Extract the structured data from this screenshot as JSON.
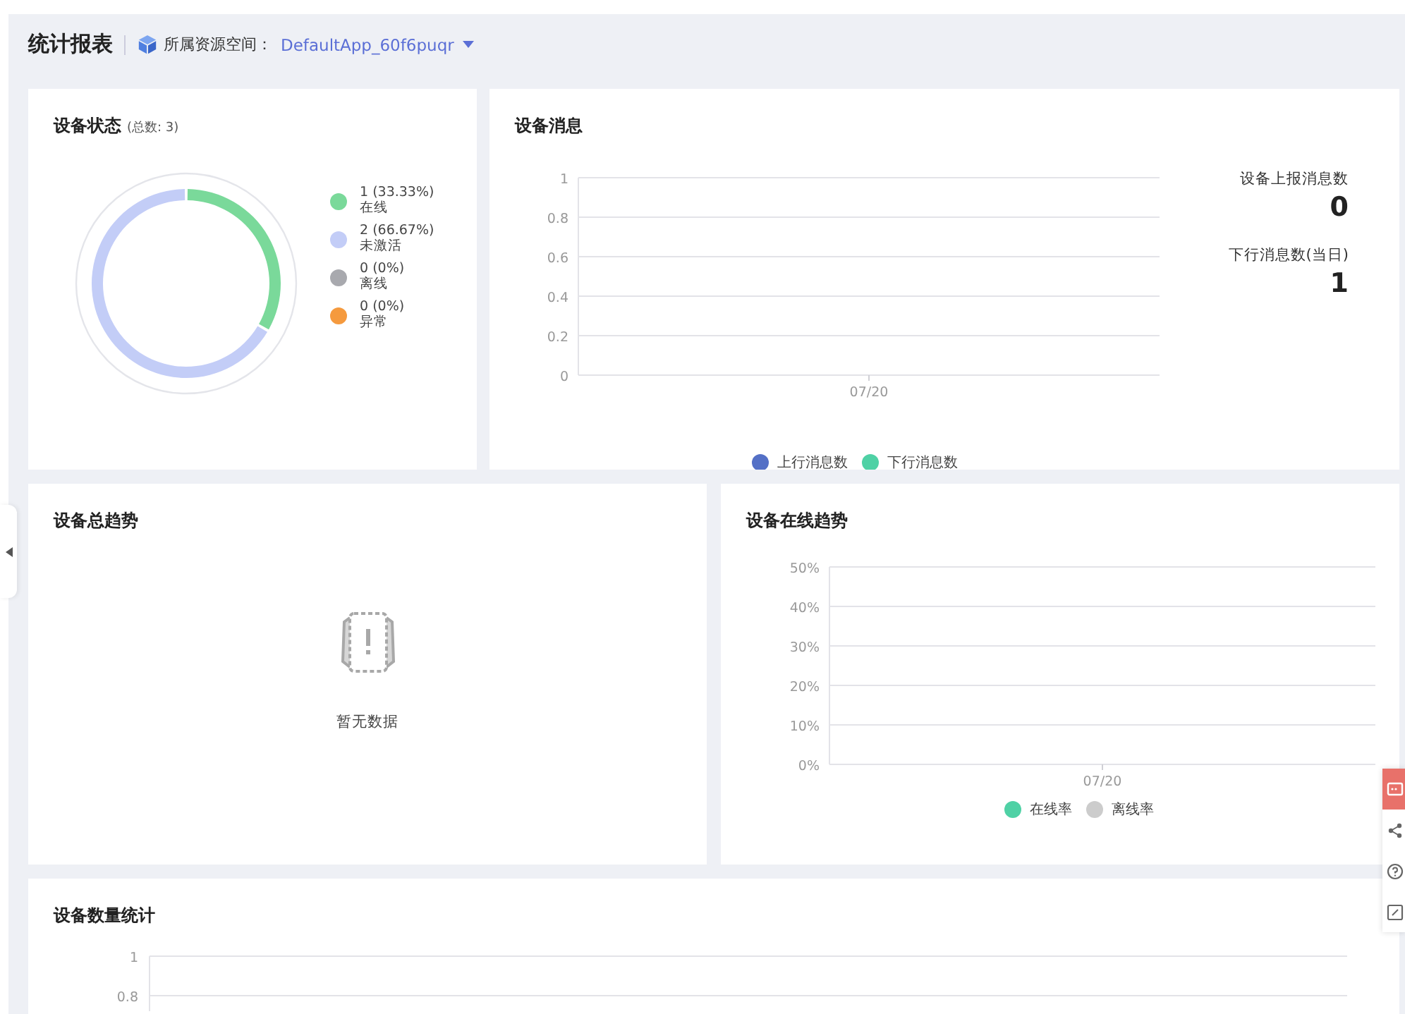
{
  "header": {
    "title": "统计报表",
    "space_label": "所属资源空间：",
    "space_value": "DefaultApp_60f6puqr"
  },
  "device_status": {
    "title": "设备状态",
    "total": "(总数: 3)",
    "legend": [
      {
        "value_label": "1 (33.33%)",
        "color": "#7ad99a"
      },
      {
        "value_label": "2 (66.67%)",
        "color": "#c3cdf7"
      },
      {
        "value_label": "0 (0%)",
        "color": "#a8a9ae"
      },
      {
        "value_label": "0 (0%)",
        "color": "#f59a3e"
      }
    ],
    "chart_data": {
      "type": "donut",
      "categories": [
        "在线",
        "未激活",
        "离线",
        "异常"
      ],
      "values": [
        33.33,
        66.67,
        0,
        0
      ]
    }
  },
  "device_messages": {
    "title": "设备消息",
    "chart_data": {
      "type": "line",
      "grid": true,
      "categories": [
        "07/20"
      ],
      "ylim": [
        0,
        1
      ],
      "yticks": [
        0,
        0.2,
        0.4,
        0.6,
        0.8,
        1
      ],
      "series": [
        {
          "name": "上行消息数",
          "color": "#5470c6",
          "values": [
            null
          ]
        },
        {
          "name": "下行消息数",
          "color": "#4fd1a5",
          "values": [
            null
          ]
        }
      ]
    },
    "stats": [
      {
        "label": "设备上报消息数",
        "value": "0"
      },
      {
        "label": "下行消息数(当日)",
        "value": "1"
      }
    ]
  },
  "device_trend": {
    "title": "设备总趋势",
    "empty_text": "暂无数据"
  },
  "online_trend": {
    "title": "设备在线趋势",
    "chart_data": {
      "type": "line",
      "grid": true,
      "categories": [
        "07/20"
      ],
      "ylim": [
        0,
        50
      ],
      "yticks": [
        {
          "value": 0,
          "label": "0%"
        },
        {
          "value": 10,
          "label": "10%"
        },
        {
          "value": 20,
          "label": "20%"
        },
        {
          "value": 30,
          "label": "30%"
        },
        {
          "value": 40,
          "label": "40%"
        },
        {
          "value": 50,
          "label": "50%"
        }
      ],
      "series": [
        {
          "name": "在线率",
          "color": "#4fd1a5",
          "values": [
            null
          ]
        },
        {
          "name": "离线率",
          "color": "#cccccc",
          "values": [
            null
          ]
        }
      ]
    }
  },
  "device_count": {
    "title": "设备数量统计",
    "axis_labels": [
      "1",
      "0.8"
    ]
  }
}
